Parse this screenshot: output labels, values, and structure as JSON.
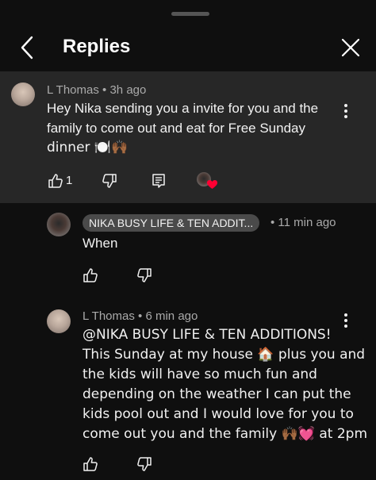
{
  "header": {
    "title": "Replies",
    "back_icon": "chevron-left-icon",
    "close_icon": "close-icon"
  },
  "parent_comment": {
    "author": "L Thomas",
    "time": "3h ago",
    "text_lines": [
      "Hey Nika sending you a invite for you and the",
      "family to come out and eat for Free Sunday",
      "dinner 🍽️🙌🏾"
    ],
    "like_count": "1",
    "creator_heart": true
  },
  "replies": [
    {
      "author": "NIKA BUSY LIFE & TEN ADDIT...",
      "is_creator": true,
      "time": "11 min ago",
      "text_lines": [
        "When"
      ]
    },
    {
      "author": "L Thomas",
      "is_creator": false,
      "time": "6 min ago",
      "text_lines": [
        "@NIKA BUSY LIFE & TEN ADDITIONS!",
        "This Sunday at my house 🏠 plus you and",
        "the kids will have so much fun and",
        "depending on the weather I can put the",
        "kids pool out and I would love for you to",
        "come out you and the family 🙌🏾💓 at 2pm"
      ]
    }
  ],
  "colors": {
    "background": "#0f0f0f",
    "highlight": "#272727",
    "text": "#f1f1f1",
    "meta": "#aaaaaa",
    "heart": "#ff0033"
  }
}
